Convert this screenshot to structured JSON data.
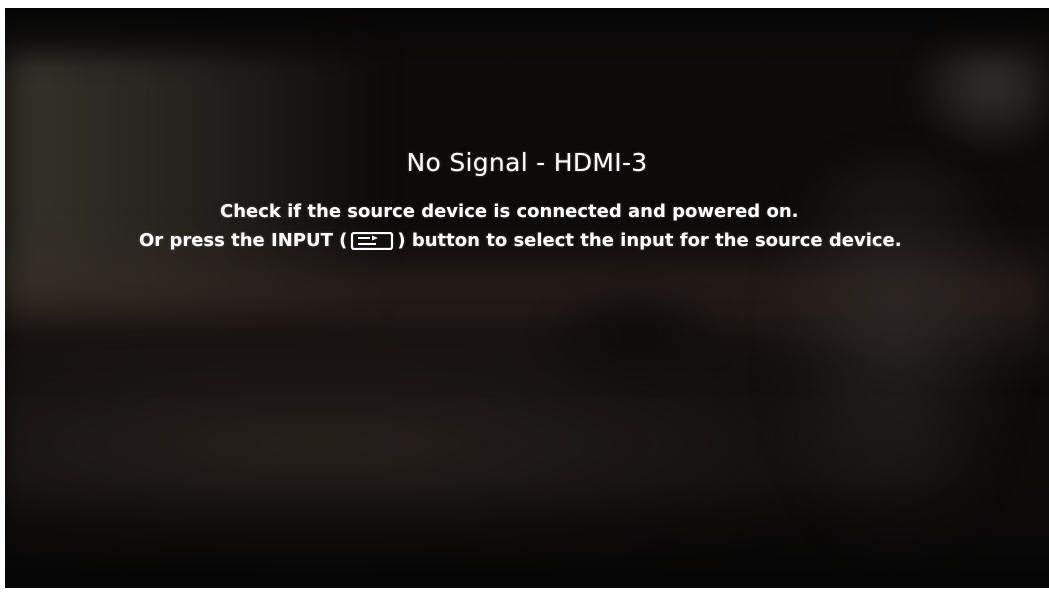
{
  "osd": {
    "title": "No Signal - HDMI-3",
    "line1": "Check if the source device is connected and powered on.",
    "line2_prefix": "Or press the INPUT (",
    "line2_suffix": ") button to select the input for the source device."
  },
  "icons": {
    "input_icon": "input-source-icon"
  },
  "colors": {
    "text": "#ffffff",
    "screen_background": "#0d0b0a"
  }
}
